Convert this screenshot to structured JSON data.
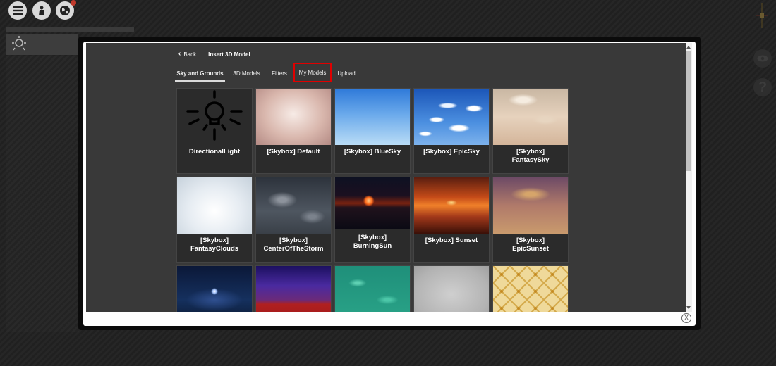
{
  "toolbar": {
    "menu_icon": "menu-icon",
    "user_icon": "person-icon",
    "globe_icon": "globe-icon"
  },
  "modal": {
    "back_label": "Back",
    "title": "Insert 3D Model",
    "close_label": "X",
    "tabs": [
      {
        "label": "Sky and Grounds",
        "active": true
      },
      {
        "label": "3D Models",
        "active": false
      },
      {
        "label": "Filters",
        "active": false
      },
      {
        "label": "My Models",
        "active": false,
        "highlighted": true
      },
      {
        "label": "Upload",
        "active": false
      }
    ],
    "items": [
      {
        "label": "DirectionalLight",
        "thumbnail": "lightbulb-icon"
      },
      {
        "label": "[Skybox] Default"
      },
      {
        "label": "[Skybox] BlueSky"
      },
      {
        "label": "[Skybox] EpicSky"
      },
      {
        "label": "[Skybox] FantasySky"
      },
      {
        "label": "[Skybox] FantasyClouds"
      },
      {
        "label": "[Skybox] CenterOfTheStorm"
      },
      {
        "label": "[Skybox] BurningSun"
      },
      {
        "label": "[Skybox] Sunset"
      },
      {
        "label": "[Skybox] EpicSunset"
      },
      {
        "label": ""
      },
      {
        "label": ""
      },
      {
        "label": ""
      },
      {
        "label": ""
      },
      {
        "label": ""
      }
    ]
  },
  "colors": {
    "highlight": "#e00000",
    "modal_bg": "#393939",
    "card_bg": "#2b2b2b"
  }
}
